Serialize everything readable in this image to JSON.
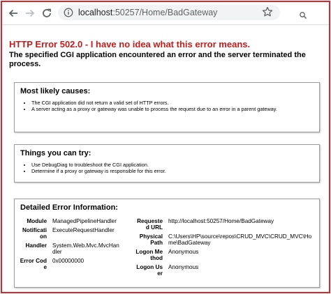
{
  "browser": {
    "url_host": "localhost",
    "url_path": ":50257/Home/BadGateway"
  },
  "page": {
    "title": "HTTP Error 502.0 - I have no idea what this error means.",
    "subtitle": "The specified CGI application encountered an error and the server terminated the process."
  },
  "causes": {
    "heading": "Most likely causes:",
    "items": [
      "The CGI application did not return a valid set of HTTP errors.",
      "A server acting as a proxy or gateway was unable to process the request due to an error in a parent gateway."
    ]
  },
  "tries": {
    "heading": "Things you can try:",
    "items": [
      "Use DebugDiag to troubleshoot the CGI application.",
      "Determine if a proxy or gateway is responsible for this error."
    ]
  },
  "details": {
    "heading": "Detailed Error Information:",
    "left": [
      {
        "label": "Module",
        "value": "ManagedPipelineHandler"
      },
      {
        "label": "Notification",
        "value": "ExecuteRequestHandler"
      },
      {
        "label": "Handler",
        "value": "System.Web.Mvc.MvcHandler"
      },
      {
        "label": "Error Code",
        "value": "0x00000000"
      }
    ],
    "right": [
      {
        "label": "Requested URL",
        "value": "http://localhost:50257/Home/BadGateway"
      },
      {
        "label": "Physical Path",
        "value": "C:\\Users\\HP\\source\\repos\\CRUD_MVC\\CRUD_MVC\\Home\\BadGateway"
      },
      {
        "label": "Logon Method",
        "value": "Anonymous"
      },
      {
        "label": "Logon User",
        "value": "Anonymous"
      }
    ]
  }
}
